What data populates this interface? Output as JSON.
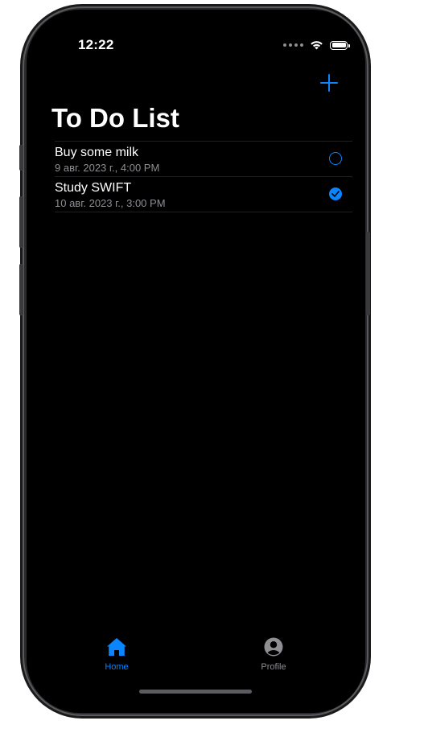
{
  "status_bar": {
    "time": "12:22"
  },
  "nav": {
    "title": "To Do List",
    "add_icon": "plus-icon"
  },
  "todos": [
    {
      "title": "Buy some milk",
      "date": "9 авг. 2023 г., 4:00 PM",
      "completed": false
    },
    {
      "title": "Study SWIFT",
      "date": "10 авг. 2023 г., 3:00 PM",
      "completed": true
    }
  ],
  "tabs": [
    {
      "label": "Home",
      "icon": "house-icon",
      "selected": true
    },
    {
      "label": "Profile",
      "icon": "person-circle-icon",
      "selected": false
    }
  ],
  "colors": {
    "accent": "#0a84ff",
    "background": "#000000",
    "secondary_text": "#8e8e93"
  }
}
